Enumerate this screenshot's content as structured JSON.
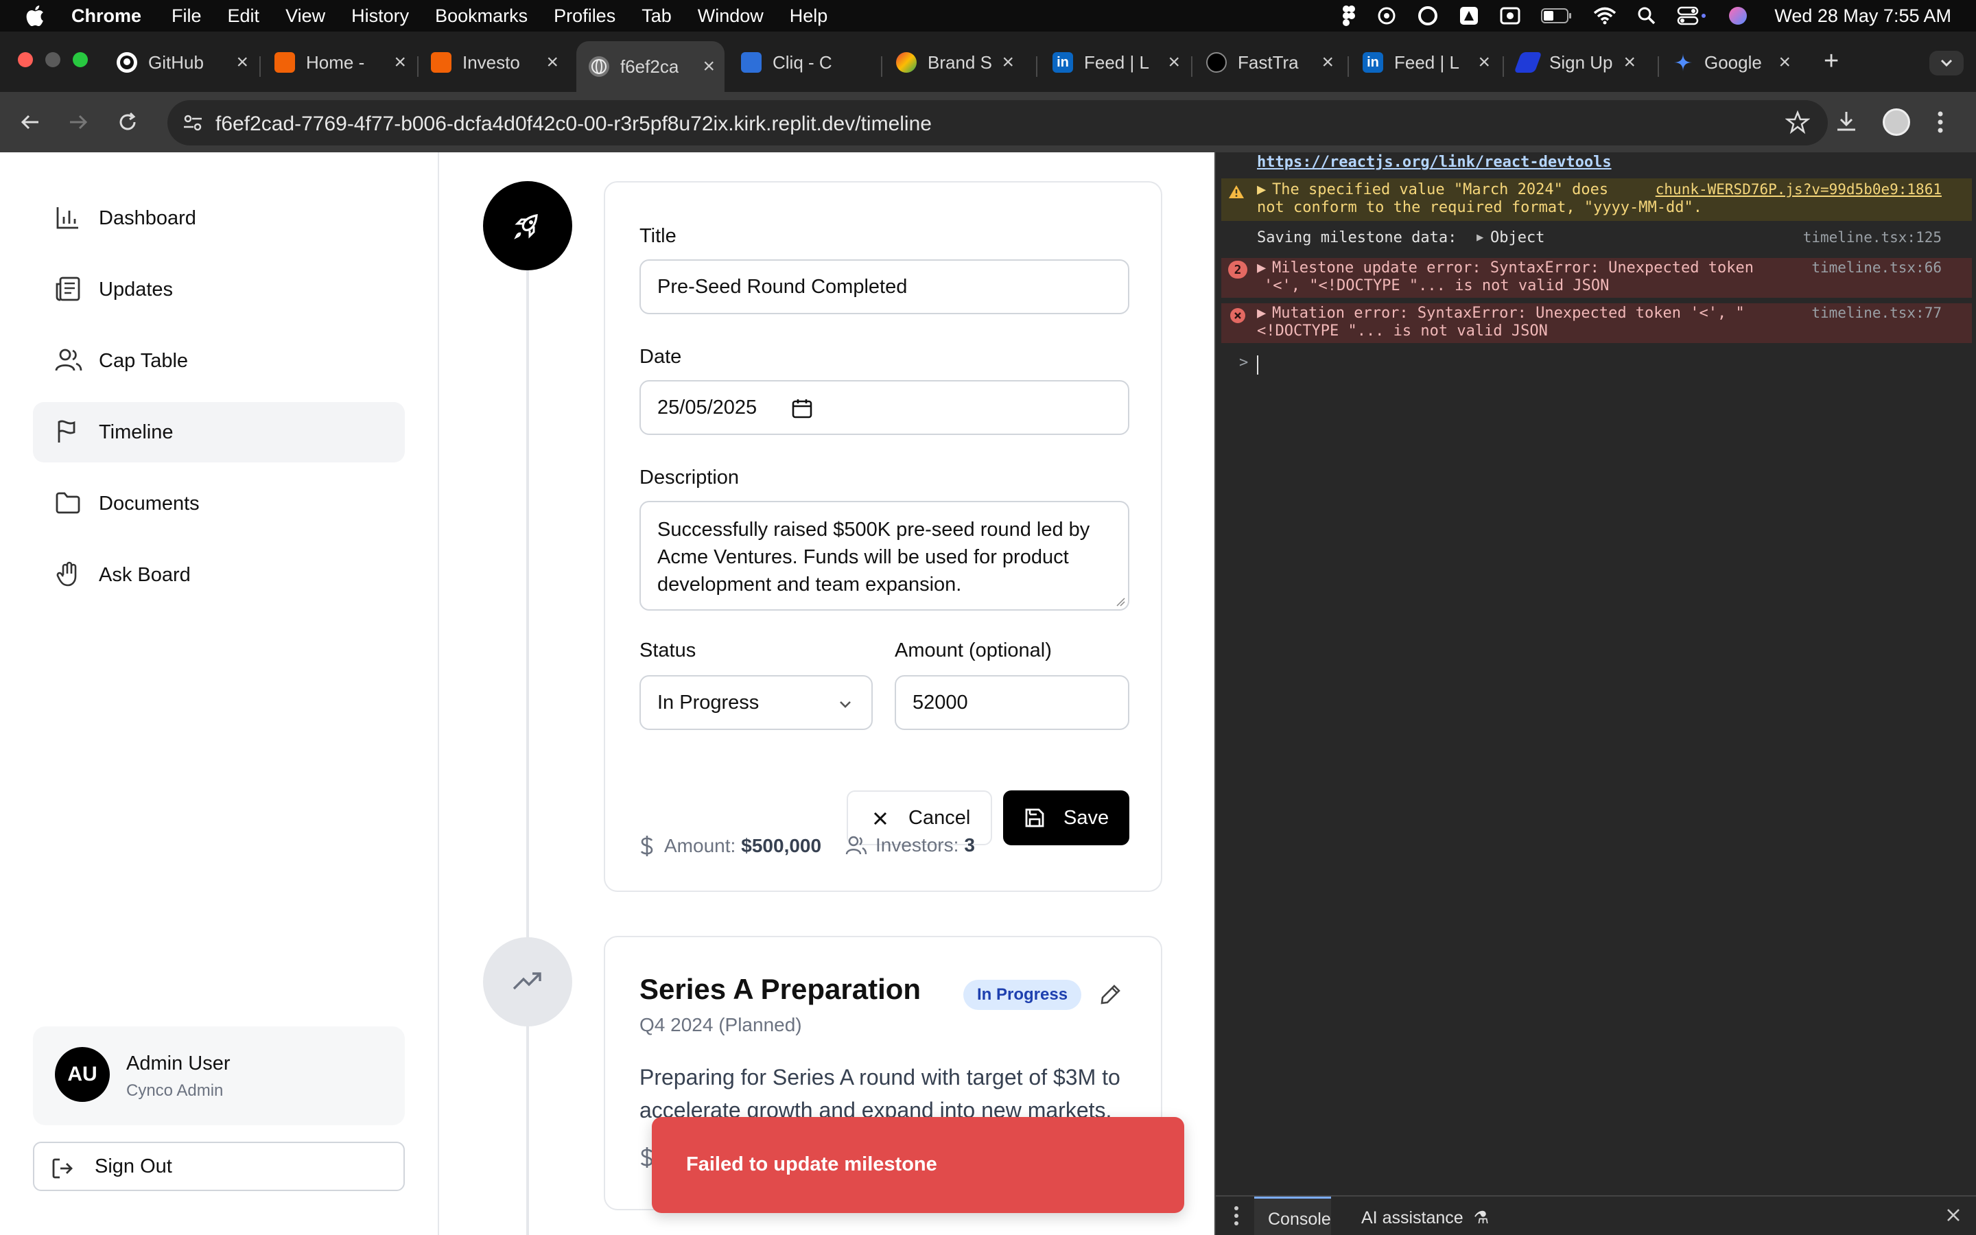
{
  "menubar": {
    "app_name": "Chrome",
    "items": [
      "File",
      "Edit",
      "View",
      "History",
      "Bookmarks",
      "Profiles",
      "Tab",
      "Window",
      "Help"
    ],
    "clock": "Wed 28 May  7:55 AM"
  },
  "tabs": [
    {
      "label": "GitHub",
      "icon": "github-icon"
    },
    {
      "label": "Home -",
      "icon": "replit-icon"
    },
    {
      "label": "Investo",
      "icon": "replit-icon"
    },
    {
      "label": "f6ef2ca",
      "icon": "globe-icon"
    },
    {
      "label": "Cliq - C",
      "icon": "chat-icon"
    },
    {
      "label": "Brand S",
      "icon": "brand-icon"
    },
    {
      "label": "Feed | L",
      "icon": "linkedin-icon"
    },
    {
      "label": "FastTra",
      "icon": "fasttrack-icon"
    },
    {
      "label": "Feed | L",
      "icon": "linkedin-icon"
    },
    {
      "label": "Sign Up",
      "icon": "signup-icon"
    },
    {
      "label": "Google",
      "icon": "gemini-icon"
    }
  ],
  "address_bar": {
    "url": "f6ef2cad-7769-4f77-b006-dcfa4d0f42c0-00-r3r5pf8u72ix.kirk.replit.dev/timeline"
  },
  "sidebar": {
    "items": [
      {
        "label": "Dashboard",
        "icon": "bar-chart-icon"
      },
      {
        "label": "Updates",
        "icon": "newspaper-icon"
      },
      {
        "label": "Cap Table",
        "icon": "users-icon"
      },
      {
        "label": "Timeline",
        "icon": "flag-icon",
        "active": true
      },
      {
        "label": "Documents",
        "icon": "folder-icon"
      },
      {
        "label": "Ask Board",
        "icon": "hand-icon"
      }
    ],
    "user": {
      "initials": "AU",
      "name": "Admin User",
      "role": "Cynco Admin"
    },
    "sign_out": "Sign Out"
  },
  "edit_form": {
    "title_label": "Title",
    "title_value": "Pre-Seed Round Completed",
    "date_label": "Date",
    "date_value": "25/05/2025",
    "description_label": "Description",
    "description_lines": [
      "Successfully raised $500K pre-seed round led by",
      "Acme Ventures. Funds will be used for product",
      "development and team expansion."
    ],
    "status_label": "Status",
    "status_value": "In Progress",
    "amount_label": "Amount (optional)",
    "amount_value": "52000",
    "cancel_label": "Cancel",
    "save_label": "Save",
    "meta_amount_label": "Amount:",
    "meta_amount_value": "$500,000",
    "meta_investors_label": "Investors:",
    "meta_investors_value": "3"
  },
  "milestone_2": {
    "title": "Series A Preparation",
    "badge": "In Progress",
    "subtitle": "Q4 2024 (Planned)",
    "description_lines": [
      "Preparing for Series A round with target of $3M to",
      "accelerate growth and expand into new markets."
    ]
  },
  "toast": {
    "message": "Failed to update milestone"
  },
  "devtools": {
    "top_link": "https://reactjs.org/link/react-devtools",
    "warning": {
      "line1": "The specified value \"March 2024\" does",
      "line2": "not conform to the required format, \"yyyy-MM-dd\".",
      "source": "chunk-WERSD76P.js?v=99d5b0e9:1861"
    },
    "log": {
      "text": "Saving milestone data:",
      "object": "Object",
      "source": "timeline.tsx:125"
    },
    "error1": {
      "count": "2",
      "line1": "Milestone update error: SyntaxError: Unexpected token",
      "line2": "'<', \"<!DOCTYPE \"... is not valid JSON",
      "source": "timeline.tsx:66"
    },
    "error2": {
      "line1": "Mutation error: SyntaxError: Unexpected token '<', \"",
      "line2": "<!DOCTYPE \"... is not valid JSON",
      "source": "timeline.tsx:77"
    },
    "prompt": ">",
    "footer_tabs": [
      "Console",
      "AI assistance"
    ]
  },
  "colors": {
    "toast_bg": "#e14b4b",
    "badge_bg": "#dbeafe",
    "badge_text": "#1e40af",
    "primary": "#000000"
  }
}
